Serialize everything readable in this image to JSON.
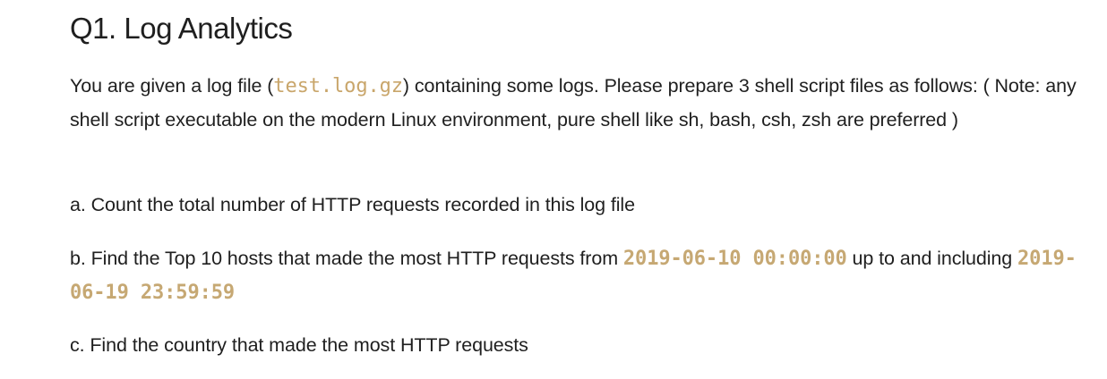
{
  "heading": "Q1. Log Analytics",
  "intro": {
    "before": "You are given a log file (",
    "file": "test.log.gz",
    "after": ") containing some logs. Please prepare 3 shell script files as follows: ( Note: any shell script executable on the modern Linux environment, pure shell like sh, bash, csh, zsh are preferred )"
  },
  "item_a": "a. Count the total number of HTTP requests recorded in this log file",
  "item_b": {
    "before": "b. Find the Top 10 hosts that made the most HTTP requests from ",
    "start_ts": "2019-06-10 00:00:00",
    "middle": " up to and including ",
    "end_ts": "2019-06-19 23:59:59"
  },
  "item_c": "c. Find the country that made the most HTTP requests",
  "colors": {
    "text": "#1f1f1f",
    "code": "#c9a66b"
  }
}
